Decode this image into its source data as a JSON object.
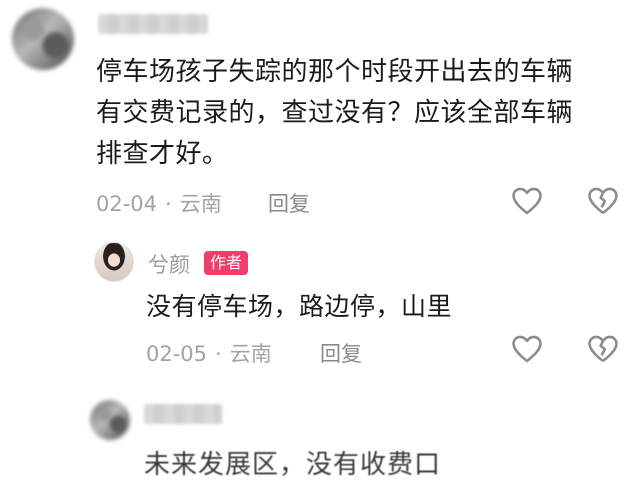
{
  "comment1": {
    "username": "昵称已模糊",
    "lines": [
      "停车场孩子失踪的那个时段开出去的车辆",
      "有交费记录的，查过没有？应该全部车辆",
      "排查才好。"
    ],
    "date": "02-04",
    "separator": "·",
    "location": "云南",
    "reply_label": "回复",
    "like_icon": "heart-outline-icon",
    "dislike_icon": "broken-heart-icon"
  },
  "reply": {
    "username": "兮颜",
    "author_badge": "作者",
    "text": "没有停车场，路边停，山里",
    "date": "02-05",
    "separator": "·",
    "location": "云南",
    "reply_label": "回复",
    "like_icon": "heart-outline-icon",
    "dislike_icon": "broken-heart-icon"
  },
  "comment2": {
    "partial_text": "未来发展区，没有收费口"
  },
  "colors": {
    "badge": "#f23d6a",
    "meta_gray": "#a3a3a3",
    "text": "#1b1b1b"
  }
}
